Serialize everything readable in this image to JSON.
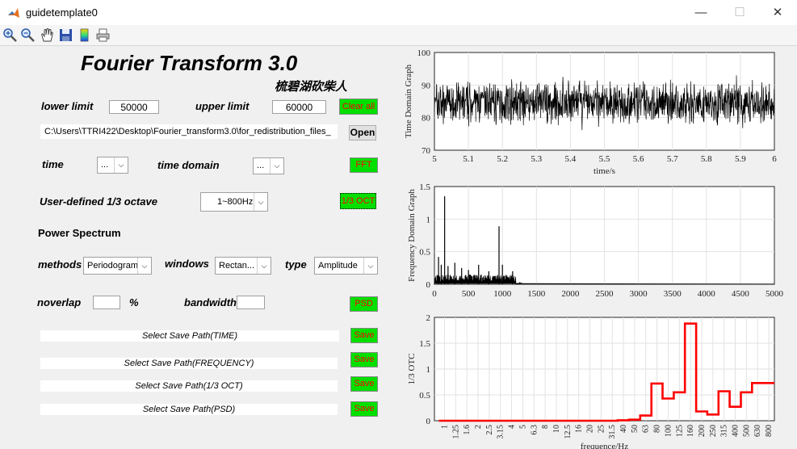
{
  "window": {
    "title": "guidetemplate0",
    "minimize": "—",
    "maximize": "☐",
    "close": "✕"
  },
  "toolbar": {
    "icons": [
      "zoom-in-icon",
      "zoom-out-icon",
      "pan-icon",
      "save-icon",
      "colorbar-icon",
      "print-icon"
    ]
  },
  "header": {
    "title": "Fourier Transform 3.0",
    "author": "梳碧湖砍柴人"
  },
  "limits": {
    "lower_label": "lower limit",
    "lower_value": "50000",
    "upper_label": "upper limit",
    "upper_value": "60000",
    "clear_label": "Clear all"
  },
  "file": {
    "path": "C:\\Users\\TTRI422\\Desktop\\Fourier_transform3.0\\for_redistribution_files_",
    "open_label": "Open"
  },
  "time_row": {
    "time_label": "time",
    "time_value": "...",
    "domain_label": "time domain",
    "domain_value": "...",
    "fft_label": "FFT"
  },
  "octave": {
    "label": "User-defined 1/3 octave",
    "value": "1~800Hz",
    "button_label": "1/3 OCT"
  },
  "power": {
    "heading": "Power Spectrum",
    "methods_label": "methods",
    "methods_value": "Periodogram",
    "windows_label": "windows",
    "windows_value": "Rectan...",
    "type_label": "type",
    "type_value": "Amplitude",
    "noverlap_label": "noverlap",
    "percent": "%",
    "bandwidth_label": "bandwidth",
    "psd_label": "PSD"
  },
  "save": [
    {
      "label": "Select Save Path(TIME)",
      "button": "Save"
    },
    {
      "label": "Select Save Path(FREQUENCY)",
      "button": "Save"
    },
    {
      "label": "Select Save Path(1/3 OCT)",
      "button": "Save"
    },
    {
      "label": "Select Save Path(PSD)",
      "button": "Save"
    }
  ],
  "colors": {
    "accent_green": "#00e000",
    "button_text_red": "#ff0000",
    "line_red": "#ff0000"
  },
  "chart_data": [
    {
      "type": "line",
      "title": "",
      "ylabel": "Time Domain Graph",
      "xlabel": "time/s",
      "xlim": [
        5,
        6
      ],
      "ylim": [
        70,
        100
      ],
      "xticks": [
        "5",
        "5.1",
        "5.2",
        "5.3",
        "5.4",
        "5.5",
        "5.6",
        "5.7",
        "5.8",
        "5.9",
        "6"
      ],
      "yticks": [
        "70",
        "80",
        "90",
        "100"
      ],
      "grid": true,
      "series": [
        {
          "description": "dense noisy signal oscillating roughly between 76 and 93, centered near 84",
          "mean": 84.5,
          "min": 76,
          "max": 93
        }
      ]
    },
    {
      "type": "line",
      "title": "",
      "ylabel": "Frequency Domain Graph",
      "xlabel": "",
      "xlim": [
        0,
        5000
      ],
      "ylim": [
        0,
        1.5
      ],
      "xticks": [
        "0",
        "500",
        "1000",
        "1500",
        "2000",
        "2500",
        "3000",
        "3500",
        "4000",
        "4500",
        "5000"
      ],
      "yticks": [
        "0",
        "0.5",
        "1",
        "1.5"
      ],
      "grid": true,
      "peaks": [
        {
          "x": 60,
          "y": 0.42
        },
        {
          "x": 100,
          "y": 0.3
        },
        {
          "x": 150,
          "y": 1.35
        },
        {
          "x": 200,
          "y": 0.28
        },
        {
          "x": 300,
          "y": 0.33
        },
        {
          "x": 400,
          "y": 0.25
        },
        {
          "x": 500,
          "y": 0.22
        },
        {
          "x": 650,
          "y": 0.3
        },
        {
          "x": 800,
          "y": 0.2
        },
        {
          "x": 950,
          "y": 0.89
        },
        {
          "x": 1000,
          "y": 0.3
        },
        {
          "x": 1150,
          "y": 0.2
        }
      ]
    },
    {
      "type": "line",
      "title": "",
      "ylabel": "1/3 OTC",
      "xlabel": "frequence/Hz",
      "ylim": [
        0,
        2
      ],
      "yticks": [
        "0",
        "0.5",
        "1",
        "1.5",
        "2"
      ],
      "grid": true,
      "categories": [
        "1",
        "1.25",
        "1.6",
        "2",
        "2.5",
        "3.15",
        "4",
        "5",
        "6.3",
        "8",
        "10",
        "12.5",
        "16",
        "20",
        "25",
        "31.5",
        "40",
        "50",
        "63",
        "80",
        "100",
        "125",
        "160",
        "200",
        "250",
        "315",
        "400",
        "500",
        "630",
        "800"
      ],
      "series": [
        {
          "name": "",
          "values": [
            0,
            0,
            0,
            0,
            0,
            0,
            0,
            0,
            0,
            0,
            0,
            0,
            0,
            0,
            0,
            0,
            0.01,
            0.02,
            0.1,
            0.72,
            0.43,
            0.55,
            1.88,
            0.18,
            0.12,
            0.57,
            0.27,
            0.55,
            0.73,
            0.73
          ]
        }
      ]
    }
  ]
}
